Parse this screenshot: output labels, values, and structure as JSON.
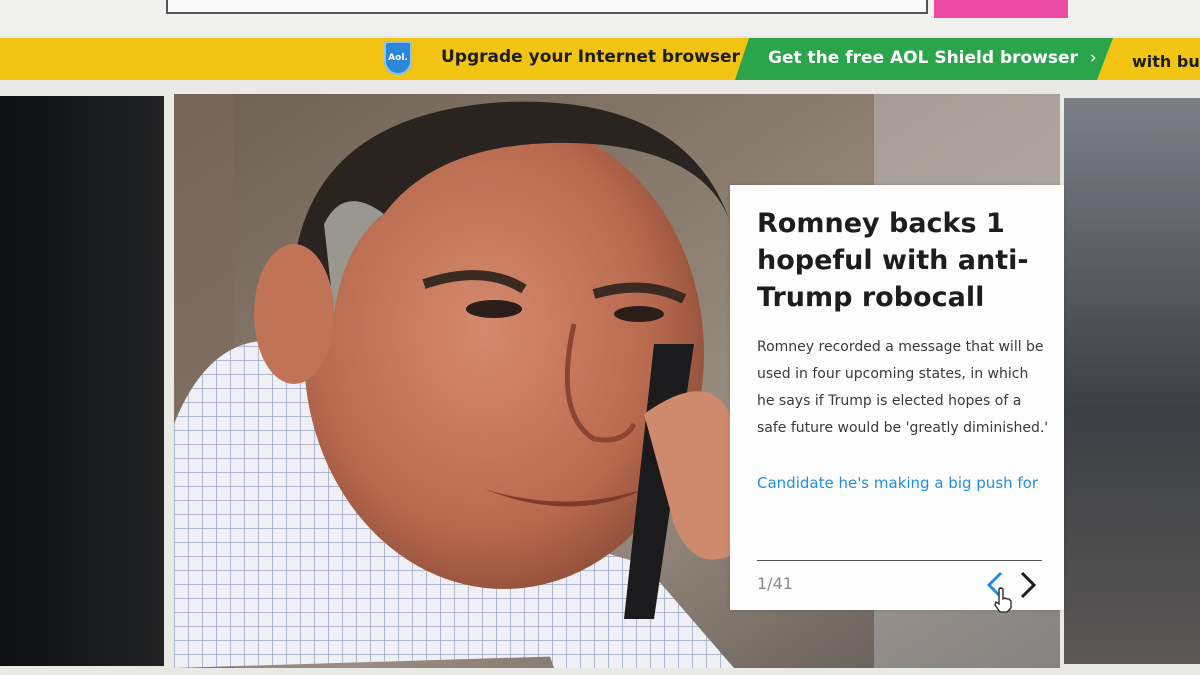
{
  "banner": {
    "shield_logo": "Aol.",
    "upgrade_text": "Upgrade your Internet browser",
    "cta_text": "Get the free AOL Shield browser",
    "cta_chevron": "›",
    "tail_text": "with bu",
    "colors": {
      "banner_bg": "#f2c515",
      "cta_bg": "#2aa54b",
      "shield": "#2a86d8"
    }
  },
  "top": {
    "accent_button_color": "#ea4aa1"
  },
  "slide": {
    "title": "Romney backs 1 hopeful with anti-Trump robocall",
    "summary": "Romney recorded a message that will be used in four upcoming states, in which he says if Trump is elected hopes of a safe future would be 'greatly diminished.'",
    "link_text": "Candidate he's making a big push for",
    "counter": "1/41",
    "prev_icon": "chevron-left-icon",
    "next_icon": "chevron-right-icon",
    "link_color": "#1f8fe6"
  }
}
